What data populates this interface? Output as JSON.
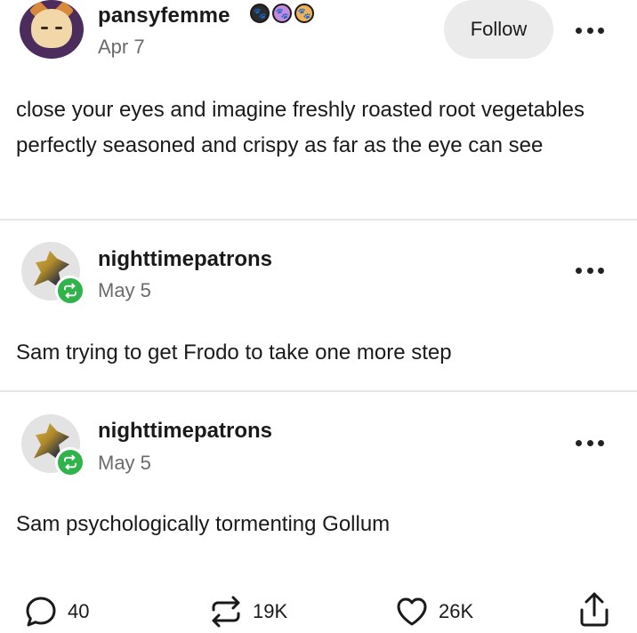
{
  "post": {
    "author": "pansyfemme",
    "date": "Apr 7",
    "follow_label": "Follow",
    "badges": [
      "paw-badge-dark-icon",
      "paw-badge-purple-icon",
      "paw-badge-orange-icon"
    ],
    "text": "close your eyes and imagine freshly roasted root vegetables perfectly seasoned and crispy as far as the eye can see"
  },
  "reblogs": [
    {
      "author": "nighttimepatrons",
      "date": "May 5",
      "text": "Sam trying to get Frodo to take one more step"
    },
    {
      "author": "nighttimepatrons",
      "date": "May 5",
      "text": "Sam psychologically tormenting Gollum"
    }
  ],
  "footer": {
    "comments": "40",
    "reblogs": "19K",
    "likes": "26K"
  },
  "colors": {
    "reblog_badge": "#2fb34a",
    "follow_bg": "#ebebeb",
    "muted_text": "#6b6b6b"
  }
}
